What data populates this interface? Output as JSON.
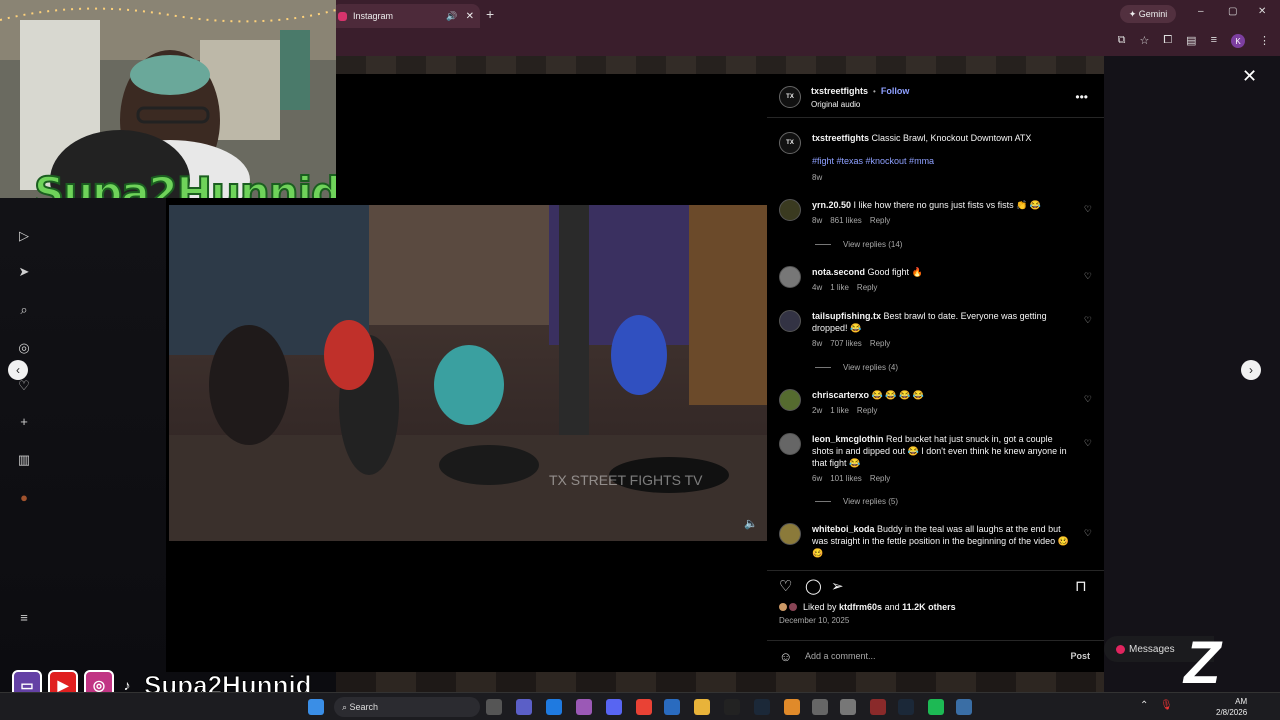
{
  "browser": {
    "tab_title": "Instagram",
    "new_tab": "+",
    "gemini_label": "Gemini",
    "profile_initial": "K",
    "window_controls": [
      "–",
      "▢",
      "✕"
    ]
  },
  "post": {
    "author": "txstreetfights",
    "follow_label": "Follow",
    "audio": "Original audio",
    "caption_user": "txstreetfights",
    "caption_text": "Classic Brawl, Knockout Downtown ATX",
    "hashtags": "#fight #texas #knockout #mma",
    "caption_age": "8w",
    "watermark": "TX STREET FIGHTS TV",
    "liked_by_prefix": "Liked by",
    "liked_by_user": "ktdfrm60s",
    "liked_by_and": "and",
    "liked_by_count": "11.2K others",
    "date": "December 10, 2025",
    "add_comment_placeholder": "Add a comment...",
    "post_label": "Post"
  },
  "comments": [
    {
      "user": "yrn.20.50",
      "text": "I like how there no guns just fists vs fists 👏 😂",
      "age": "8w",
      "likes": "861 likes",
      "reply": "Reply",
      "view_replies": "View replies (14)"
    },
    {
      "user": "nota.second",
      "text": "Good fight 🔥",
      "age": "4w",
      "likes": "1 like",
      "reply": "Reply",
      "view_replies": ""
    },
    {
      "user": "tailsupfishing.tx",
      "text": "Best brawl to date. Everyone was getting dropped! 😂",
      "age": "8w",
      "likes": "707 likes",
      "reply": "Reply",
      "view_replies": "View replies (4)"
    },
    {
      "user": "chriscarterxo",
      "text": "😂 😂 😂 😂",
      "age": "2w",
      "likes": "1 like",
      "reply": "Reply",
      "view_replies": ""
    },
    {
      "user": "leon_kmcglothin",
      "text": "Red bucket hat just snuck in, got a couple shots in and dipped out 😂 I don't even think he knew anyone in that fight 😂",
      "age": "6w",
      "likes": "101 likes",
      "reply": "Reply",
      "view_replies": "View replies (5)"
    },
    {
      "user": "whiteboi_koda",
      "text": "Buddy in the teal was all laughs at the end but was straight in the fettle position in the beginning of the video 🥴🥴",
      "age": "",
      "likes": "",
      "reply": "",
      "view_replies": ""
    }
  ],
  "overlay": {
    "webcam_name": "Supa2Hunnid",
    "bottom_name": "Supa2Hunnid",
    "logo_letter": "Z"
  },
  "messages": {
    "label": "Messages"
  },
  "taskbar": {
    "search_placeholder": "Search",
    "time": "AM",
    "date": "2/8/2026"
  },
  "colors": {
    "accent_link": "#8ea0ff",
    "chrome_bg": "#3a1e2c",
    "instagram_badge": "#e0245e",
    "webcam_text": "#6fd35a"
  },
  "icons": [
    "instagram-icon",
    "speaker-icon",
    "close-icon",
    "gemini-icon",
    "screenshot-icon",
    "star-icon",
    "extensions-icon",
    "sidebar-icon",
    "more-icon",
    "heart-icon",
    "comment-icon",
    "share-icon",
    "bookmark-icon",
    "emoji-icon",
    "chevron-left-icon",
    "chevron-right-icon"
  ]
}
